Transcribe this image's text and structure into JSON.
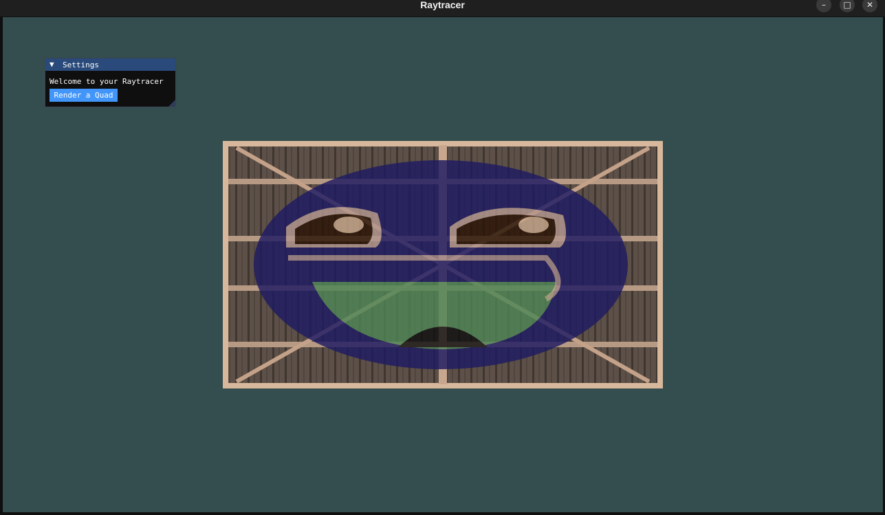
{
  "window": {
    "title": "Raytracer",
    "controls": {
      "minimize": "–",
      "maximize": "□",
      "close": "✕"
    }
  },
  "settings_panel": {
    "title": "Settings",
    "collapse_arrow": "▼",
    "welcome_text": "Welcome to your Raytracer",
    "render_button_label": "Render a Quad"
  },
  "render_output": {
    "description_icon": "rendered-quad-image"
  },
  "colors": {
    "viewport_bg": "#344d4e",
    "imgui_header": "#294a7a",
    "imgui_button": "#4296fa"
  }
}
